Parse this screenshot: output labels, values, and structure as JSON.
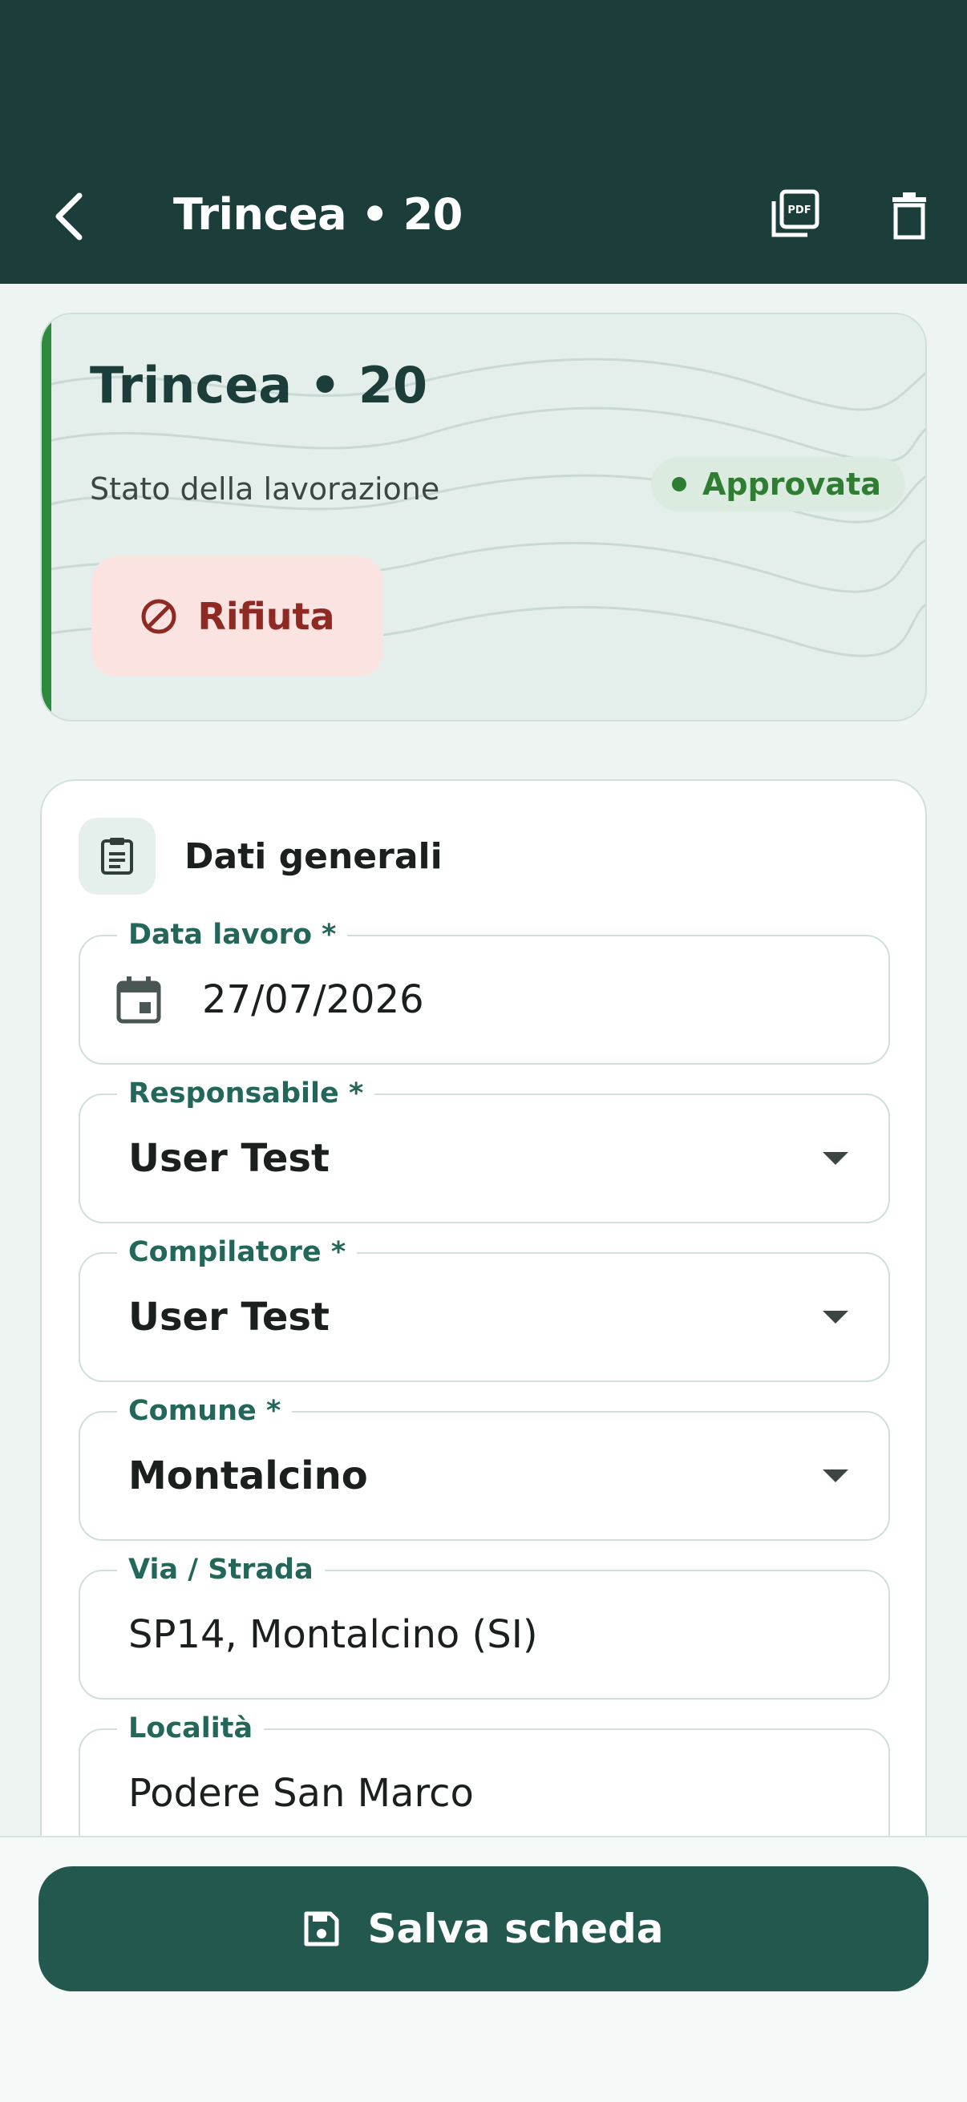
{
  "appbar": {
    "title": "Trincea • 20",
    "back_icon": "chevron-left-icon",
    "pdf_icon": "pdf-export-icon",
    "delete_icon": "trash-icon"
  },
  "status_card": {
    "title": "Trincea • 20",
    "state_label": "Stato della lavorazione",
    "badge": "Approvata",
    "reject_label": "Rifiuta"
  },
  "form": {
    "section_title": "Dati generali",
    "fields": [
      {
        "label": "Data lavoro *",
        "value": "27/07/2026"
      },
      {
        "label": "Responsabile *",
        "value": "User Test"
      },
      {
        "label": "Compilatore *",
        "value": "User Test"
      },
      {
        "label": "Comune *",
        "value": "Montalcino"
      },
      {
        "label": "Via / Strada",
        "value": "SP14, Montalcino (SI)"
      },
      {
        "label": "Località",
        "value": "Podere San Marco"
      }
    ]
  },
  "footer": {
    "save_label": "Salva scheda"
  },
  "colors": {
    "primary": "#1c3e3a",
    "button": "#23584e",
    "approved": "#2e7d32",
    "reject_bg": "#fbe3e1",
    "reject_text": "#8e2a23"
  }
}
